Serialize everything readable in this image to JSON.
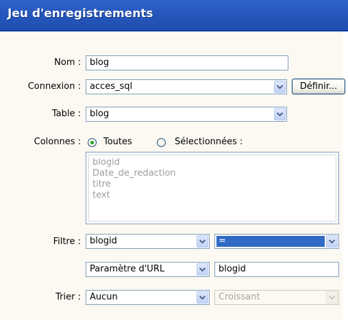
{
  "dialog": {
    "title": "Jeu d'enregistrements"
  },
  "form": {
    "nom_label": "Nom :",
    "nom_value": "blog",
    "connexion_label": "Connexion :",
    "connexion_value": "acces_sql",
    "definir_label": "Définir...",
    "table_label": "Table :",
    "table_value": "blog",
    "colonnes_label": "Colonnes :",
    "radio_toutes": "Toutes",
    "radio_selectionnees": "Sélectionnées :",
    "columns": [
      "blogid",
      "Date_de_redaction",
      "titre",
      "text"
    ],
    "filtre_label": "Filtre :",
    "filtre_column": "blogid",
    "filtre_operator": "=",
    "filtre_param_type": "Paramètre d'URL",
    "filtre_param_value": "blogid",
    "trier_label": "Trier :",
    "trier_column": "Aucun",
    "trier_order": "Croissant"
  }
}
